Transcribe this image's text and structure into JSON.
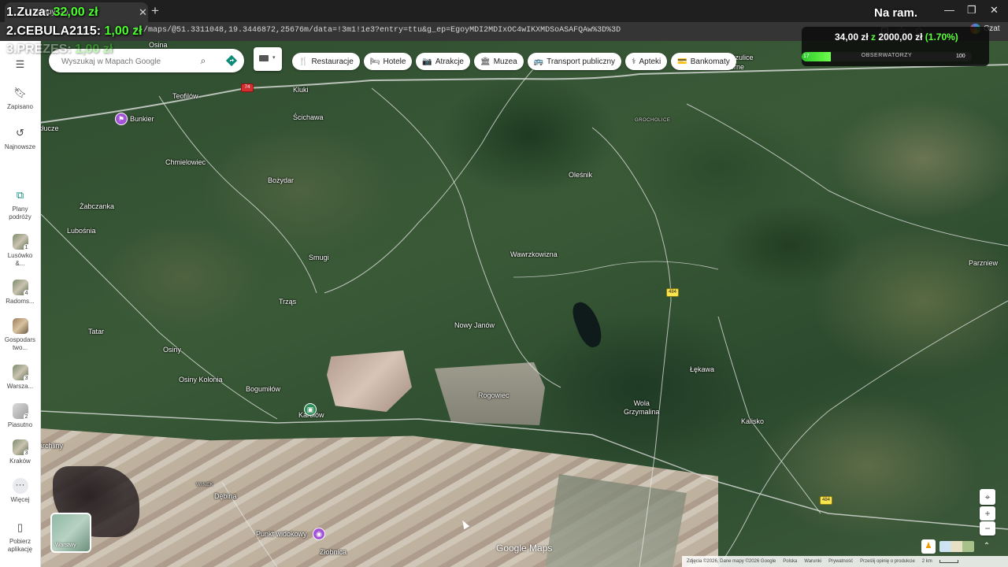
{
  "browser": {
    "tab_title": "Mapy Go",
    "url": "pl/maps/@51.3311048,19.3446872,25676m/data=!3m1!1e3?entry=ttu&g_ep=EgoyMDI2MDIxOC4wIKXMDSoASAFQAw%3D%3D",
    "czat_label": "Czat"
  },
  "stream": {
    "ranking": [
      {
        "label": "1.Zuza:",
        "amount": "32,00 zł"
      },
      {
        "label": "2.CEBULA2115:",
        "amount": "1,00 zł"
      },
      {
        "label": "3.PREZES:",
        "amount": "1,00 zł"
      }
    ],
    "title": "Na ram.",
    "goal": {
      "current": "34,00 zł",
      "connector": "z",
      "target": "2000,00 zł",
      "percent_text": "(1.70%)",
      "progress": 0.017,
      "label": "OBSERWATORZY",
      "bar_left": "17",
      "bar_right": "100"
    }
  },
  "sidebar": {
    "items": [
      {
        "label": "Zapisano",
        "icon": "bookmark-icon"
      },
      {
        "label": "Najnowsze",
        "icon": "history-icon"
      },
      {
        "label": "Plany podróży",
        "icon": "trip-icon"
      },
      {
        "label": "Lusówko &...",
        "badge": "1"
      },
      {
        "label": "Radoms...",
        "badge": "4"
      },
      {
        "label": "Gospodarstwo...",
        "badge": ""
      },
      {
        "label": "Warsza...",
        "badge": "3"
      },
      {
        "label": "Piasutno",
        "badge": "2"
      },
      {
        "label": "Kraków",
        "badge": "3"
      },
      {
        "label": "Więcej",
        "icon": "more-icon"
      },
      {
        "label": "Pobierz aplikację",
        "icon": "phone-icon"
      }
    ]
  },
  "search": {
    "placeholder": "Wyszukaj w Mapach Google"
  },
  "chips": [
    {
      "label": "Restauracje",
      "icon": "🍴"
    },
    {
      "label": "Hotele",
      "icon": "🛏"
    },
    {
      "label": "Atrakcje",
      "icon": "📷"
    },
    {
      "label": "Muzea",
      "icon": "🏛"
    },
    {
      "label": "Transport publiczny",
      "icon": "🚌"
    },
    {
      "label": "Apteki",
      "icon": "⚕"
    },
    {
      "label": "Bankomaty",
      "icon": "💳"
    }
  ],
  "places": {
    "osina": "Osina",
    "zdzieszulice": "Zdzieszulice",
    "gorne": "Górne",
    "teofilow": "Teofilów",
    "kluki": "Kluki",
    "bunkier": "Bunkier",
    "kluczne": "kłucze",
    "scichawa": "Ścichawa",
    "grocholice": "GROCHOLICE",
    "chmielowiec": "Chmielowiec",
    "olesnik": "Oleśnik",
    "bozydar": "Bożydar",
    "zabczanka": "Żabczanka",
    "lubosnia": "Lubośnia",
    "smugi": "Smugi",
    "wawrzkowizna": "Wawrzkowizna",
    "parzniew": "Parzniew",
    "trzas": "Trząs",
    "nowy_janow": "Nowy Janów",
    "tatar": "Tatar",
    "osiny": "Osiny",
    "lekawa": "Łękawa",
    "osiny_kolonia": "Osiny Kolonia",
    "bogumilow": "Bogumiłów",
    "rogowiec": "Rogowiec",
    "wola_grzymalina": "Wola\nGrzymalina",
    "karolow": "Karolów",
    "kalisko": "Kalisko",
    "chyliny": "archliny",
    "winek": "WINEK",
    "debina": "Dębina",
    "punkt": "Punkt widokowy",
    "zlobnica": "Złobnica"
  },
  "shields": {
    "r1": "74",
    "r2": "484",
    "r3": "484"
  },
  "map": {
    "layers_label": "Warstwy",
    "brand": "Google Maps",
    "footer": [
      "Zdjęcia ©2026, Dane mapy ©2026 Google",
      "Polska",
      "Warunki",
      "Prywatność",
      "Prześlij opinię o produkcie",
      "2 km"
    ]
  }
}
